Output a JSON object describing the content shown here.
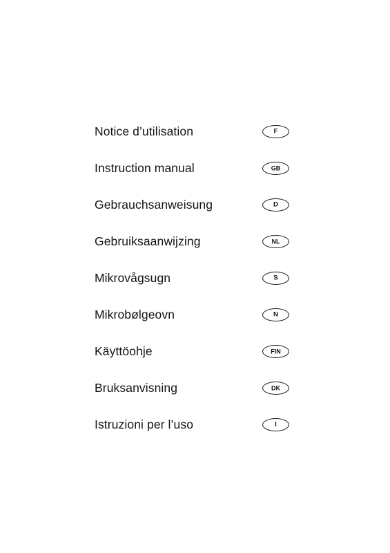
{
  "document": {
    "type": "multilingual-manual-cover",
    "page_background": "#ffffff",
    "text_color": "#141414",
    "languages": [
      {
        "title": "Notice d’utilisation",
        "code": "F",
        "code_style": "single"
      },
      {
        "title": "Instruction manual",
        "code": "GB",
        "code_style": "wide"
      },
      {
        "title": "Gebrauchsanweisung",
        "code": "D",
        "code_style": "single"
      },
      {
        "title": "Gebruiksaanwijzing",
        "code": "NL",
        "code_style": "wide"
      },
      {
        "title": "Mikrovågsugn",
        "code": "S",
        "code_style": "single"
      },
      {
        "title": "Mikrobølgeovn",
        "code": "N",
        "code_style": "single"
      },
      {
        "title": "Käyttöohje",
        "code": "FIN",
        "code_style": "wide"
      },
      {
        "title": "Bruksanvisning",
        "code": "DK",
        "code_style": "wide"
      },
      {
        "title": "Istruzioni per l’uso",
        "code": "I",
        "code_style": "single"
      }
    ]
  }
}
